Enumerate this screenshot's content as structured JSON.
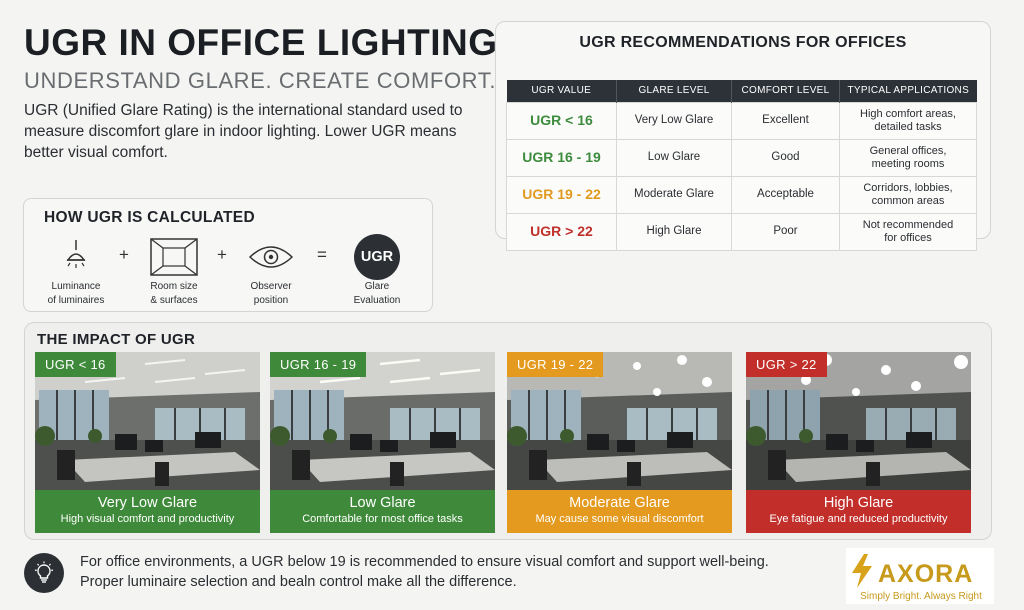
{
  "header": {
    "title": "UGR IN OFFICE LIGHTING",
    "subtitle": "UNDERSTAND GLARE. CREATE COMFORT.",
    "intro": "UGR (Unified Glare Rating) is the international standard used to measure discomfort glare in indoor lighting. Lower UGR means better visual comfort."
  },
  "calculation": {
    "title": "HOW UGR IS CALCULATED",
    "factors": [
      {
        "icon": "pendant-lamp-icon",
        "line1": "Luminance",
        "line2": "of luminaires"
      },
      {
        "icon": "room-box-icon",
        "line1": "Room size",
        "line2": "& surfaces"
      },
      {
        "icon": "eye-icon",
        "line1": "Observer",
        "line2": "position"
      }
    ],
    "result": {
      "badge": "UGR",
      "line1": "Glare",
      "line2": "Evaluation"
    },
    "plus": "+",
    "equals": "="
  },
  "recommendations": {
    "title": "UGR RECOMMENDATIONS FOR OFFICES",
    "headers": [
      "UGR VALUE",
      "GLARE LEVEL",
      "COMFORT LEVEL",
      "TYPICAL APPLICATIONS"
    ],
    "rows": [
      {
        "value": "UGR < 16",
        "glare": "Very Low Glare",
        "comfort": "Excellent",
        "app1": "High comfort areas,",
        "app2": "detailed tasks",
        "color": "#3d8b3d"
      },
      {
        "value": "UGR 16 - 19",
        "glare": "Low Glare",
        "comfort": "Good",
        "app1": "General offices,",
        "app2": "meeting rooms",
        "color": "#3d8b3d"
      },
      {
        "value": "UGR 19 - 22",
        "glare": "Moderate Glare",
        "comfort": "Acceptable",
        "app1": "Corridors, lobbies,",
        "app2": "common areas",
        "color": "#e09a1f"
      },
      {
        "value": "UGR > 22",
        "glare": "High Glare",
        "comfort": "Poor",
        "app1": "Not recommended",
        "app2": "for offices",
        "color": "#c0302c"
      }
    ]
  },
  "impact": {
    "title": "THE IMPACT OF UGR",
    "cards": [
      {
        "tag": "UGR < 16",
        "heading": "Very Low Glare",
        "desc": "High visual comfort and productivity",
        "color": "#3f8a3a"
      },
      {
        "tag": "UGR 16 - 19",
        "heading": "Low Glare",
        "desc": "Comfortable for most office tasks",
        "color": "#3f8a3a"
      },
      {
        "tag": "UGR 19 - 22",
        "heading": "Moderate Glare",
        "desc": "May cause some visual discomfort",
        "color": "#e39a1e"
      },
      {
        "tag": "UGR > 22",
        "heading": "High Glare",
        "desc": "Eye fatigue and reduced productivity",
        "color": "#c22f2b"
      }
    ]
  },
  "note": {
    "icon": "lightbulb-icon",
    "line1": "For office environments, a UGR below 19 is recommended to ensure visual comfort and support well-being.",
    "line2": "Proper luminaire selection and bealn control make all the difference."
  },
  "logo": {
    "name": "AXORA",
    "tagline": "Simply Bright. Always Right",
    "icon": "lightning-bolt-icon"
  }
}
